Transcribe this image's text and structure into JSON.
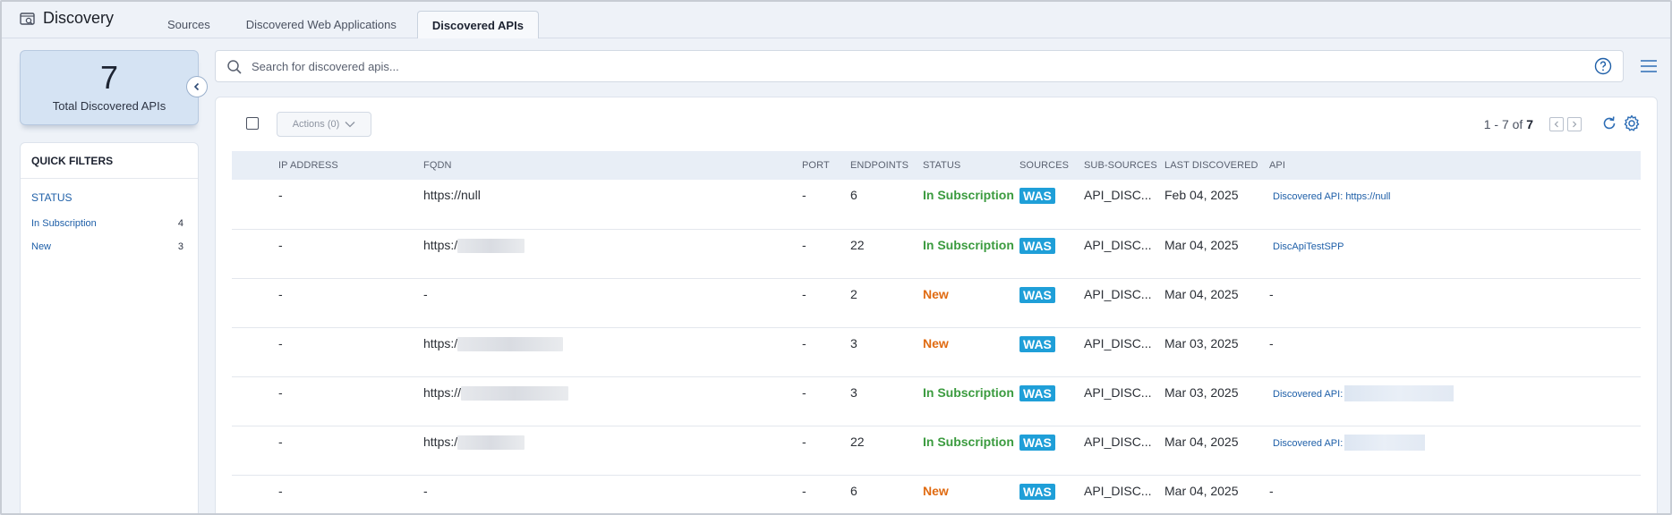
{
  "app": {
    "title": "Discovery",
    "icon": "discovery-icon"
  },
  "tabs": [
    {
      "label": "Sources",
      "active": false
    },
    {
      "label": "Discovered Web Applications",
      "active": false
    },
    {
      "label": "Discovered APIs",
      "active": true
    }
  ],
  "kpi": {
    "value": "7",
    "label": "Total Discovered APIs"
  },
  "quick_filters": {
    "title": "QUICK FILTERS",
    "group_title": "STATUS",
    "items": [
      {
        "label": "In Subscription",
        "count": "4"
      },
      {
        "label": "New",
        "count": "3"
      }
    ]
  },
  "search": {
    "placeholder": "Search for discovered apis..."
  },
  "toolbar": {
    "actions_label": "Actions (0)",
    "pager_range": "1 - 7 of",
    "pager_total": "7"
  },
  "table": {
    "columns": [
      "IP ADDRESS",
      "FQDN",
      "PORT",
      "ENDPOINTS",
      "STATUS",
      "SOURCES",
      "SUB-SOURCES",
      "LAST DISCOVERED",
      "API"
    ],
    "rows": [
      {
        "ip": "-",
        "fqdn": "https://null",
        "port": "-",
        "endpoints": "6",
        "status": "In Subscription",
        "source": "WAS",
        "sub_source": "API_DISC...",
        "last_discovered": "Feb 04, 2025",
        "api": "Discovered API: https://null"
      },
      {
        "ip": "-",
        "fqdn": "https:/",
        "port": "-",
        "endpoints": "22",
        "status": "In Subscription",
        "source": "WAS",
        "sub_source": "API_DISC...",
        "last_discovered": "Mar 04, 2025",
        "api": "DiscApiTestSPP"
      },
      {
        "ip": "-",
        "fqdn": "-",
        "port": "-",
        "endpoints": "2",
        "status": "New",
        "source": "WAS",
        "sub_source": "API_DISC...",
        "last_discovered": "Mar 04, 2025",
        "api": "-"
      },
      {
        "ip": "-",
        "fqdn": "https:/",
        "port": "-",
        "endpoints": "3",
        "status": "New",
        "source": "WAS",
        "sub_source": "API_DISC...",
        "last_discovered": "Mar 03, 2025",
        "api": "-"
      },
      {
        "ip": "-",
        "fqdn": "https://",
        "port": "-",
        "endpoints": "3",
        "status": "In Subscription",
        "source": "WAS",
        "sub_source": "API_DISC...",
        "last_discovered": "Mar 03, 2025",
        "api": "Discovered API: "
      },
      {
        "ip": "-",
        "fqdn": "https:/",
        "port": "-",
        "endpoints": "22",
        "status": "In Subscription",
        "source": "WAS",
        "sub_source": "API_DISC...",
        "last_discovered": "Mar 04, 2025",
        "api": "Discovered API: "
      },
      {
        "ip": "-",
        "fqdn": "-",
        "port": "-",
        "endpoints": "6",
        "status": "New",
        "source": "WAS",
        "sub_source": "API_DISC...",
        "last_discovered": "Mar 04, 2025",
        "api": "-"
      }
    ]
  },
  "colors": {
    "in_subscription": "#3b9b3f",
    "new": "#e06b12",
    "source_badge": "#1f9fd8",
    "link": "#1e5fa8"
  }
}
